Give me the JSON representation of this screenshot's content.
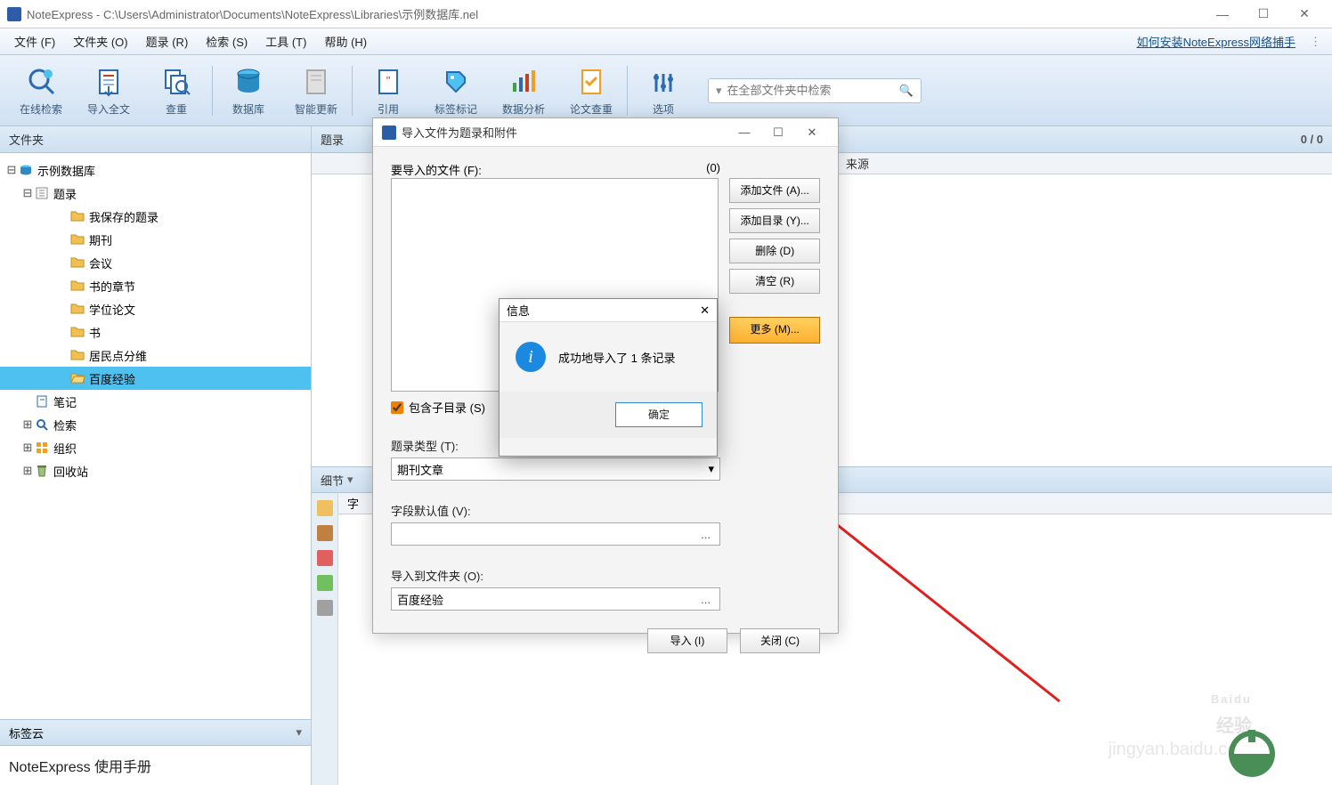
{
  "title": "NoteExpress - C:\\Users\\Administrator\\Documents\\NoteExpress\\Libraries\\示例数据库.nel",
  "menu": {
    "file": "文件 (F)",
    "folder": "文件夹 (O)",
    "record": "题录 (R)",
    "search": "检索 (S)",
    "tool": "工具 (T)",
    "help": "帮助 (H)"
  },
  "right_link": "如何安装NoteExpress网络捕手",
  "toolbar": {
    "online_search": "在线检索",
    "import_fulltext": "导入全文",
    "lookup": "查重",
    "database": "数据库",
    "smart_update": "智能更新",
    "cite": "引用",
    "tag_mark": "标签标记",
    "data_analysis": "数据分析",
    "paper_check": "论文查重",
    "options": "选项"
  },
  "search_placeholder": "在全部文件夹中检索",
  "sidebar": {
    "title": "文件夹",
    "root": "示例数据库",
    "records": "题录",
    "items": [
      "我保存的题录",
      "期刊",
      "会议",
      "书的章节",
      "学位论文",
      "书",
      "居民点分维",
      "百度经验"
    ],
    "notes": "笔记",
    "search": "检索",
    "organize": "组织",
    "recycle": "回收站"
  },
  "tagcloud": {
    "title": "标签云",
    "item": "NoteExpress  使用手册"
  },
  "main": {
    "title": "题录",
    "count": "0 / 0",
    "col_source": "来源",
    "detail": "细节",
    "field": "字"
  },
  "import": {
    "title": "导入文件为题录和附件",
    "file_label": "要导入的文件 (F):",
    "file_count": "(0)",
    "add_file": "添加文件 (A)...",
    "add_dir": "添加目录 (Y)...",
    "remove": "删除 (D)",
    "clear": "清空 (R)",
    "more": "更多 (M)...",
    "subdir": "包含子目录 (S)",
    "type_label": "题录类型 (T):",
    "type_value": "期刊文章",
    "default_label": "字段默认值 (V):",
    "target_label": "导入到文件夹 (O):",
    "target_value": "百度经验",
    "import_btn": "导入 (I)",
    "close_btn": "关闭 (C)"
  },
  "msg": {
    "title": "信息",
    "text": "成功地导入了 1 条记录",
    "ok": "确定"
  },
  "watermark": {
    "brand": "Baidu",
    "sub": "经验",
    "url": "jingyan.baidu.com"
  }
}
